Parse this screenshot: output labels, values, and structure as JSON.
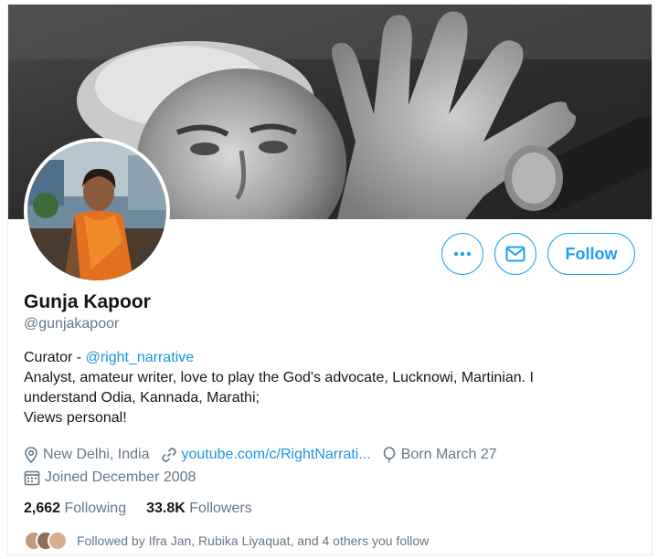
{
  "profile": {
    "name": "Gunja Kapoor",
    "handle": "@gunjakapoor",
    "bio": {
      "prefix": "Curator - ",
      "mention": "@right_narrative",
      "line2": "Analyst, amateur writer, love to play the God's advocate, Lucknowi, Martinian. I",
      "line3": "understand Odia, Kannada, Marathi;",
      "line4": "Views  personal!"
    },
    "location": "New Delhi, India",
    "website": "youtube.com/c/RightNarrati...",
    "born": "Born March 27",
    "joined": "Joined December 2008"
  },
  "actions": {
    "follow_label": "Follow",
    "more_icon": "more-icon",
    "message_icon": "message-envelope-icon"
  },
  "stats": {
    "following_count": "2,662",
    "following_label": "Following",
    "followers_count": "33.8K",
    "followers_label": "Followers"
  },
  "followed_by": {
    "text": "Followed by Ifra Jan, Rubika Liyaquat, and 4 others you follow"
  },
  "colors": {
    "accent": "#1da1f2",
    "link": "#1b95e0",
    "secondary_text": "#657786",
    "primary_text": "#14171a"
  }
}
